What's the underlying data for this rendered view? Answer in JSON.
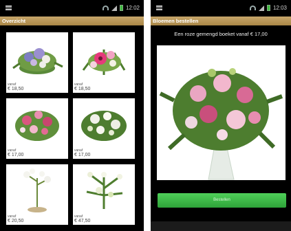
{
  "left": {
    "status_time": "12:02",
    "title": "Overzicht",
    "tiles": [
      {
        "vanaf": "vanaf",
        "price": "€ 18,50"
      },
      {
        "vanaf": "vanaf",
        "price": "€ 18,50"
      },
      {
        "vanaf": "vanaf",
        "price": "€ 17,00"
      },
      {
        "vanaf": "vanaf",
        "price": "€ 17,00"
      },
      {
        "vanaf": "vanaf",
        "price": "€ 20,50"
      },
      {
        "vanaf": "vanaf",
        "price": "€ 47,50"
      }
    ]
  },
  "right": {
    "status_time": "12:03",
    "title": "Bloemen bestellen",
    "caption": "Een roze gemengd boeket vanaf € 17,00",
    "order_button": "Bestellen"
  },
  "colors": {
    "titlebar": "#b0904f",
    "order_button": "#3dbb49"
  }
}
